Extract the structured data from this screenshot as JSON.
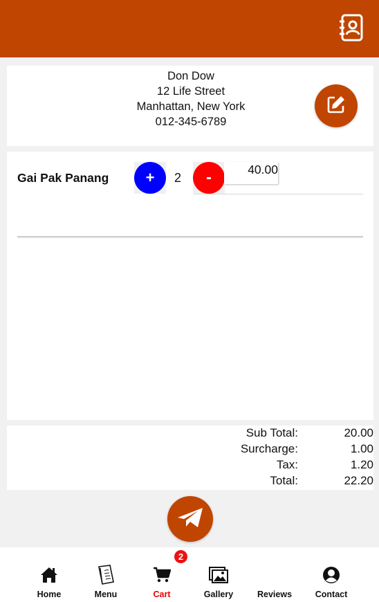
{
  "header": {
    "contacts_icon": "address-book-icon",
    "color": "#c04500"
  },
  "customer": {
    "name": "Don Dow",
    "street": "12 Life Street",
    "city": "Manhattan, New York",
    "phone": "012-345-6789",
    "edit_icon": "edit-icon"
  },
  "cart": {
    "items": [
      {
        "name": "Gai Pak Panang",
        "plus_label": "+",
        "quantity": "2",
        "minus_label": "-",
        "price": "40.00"
      }
    ]
  },
  "totals": {
    "subtotal_label": "Sub Total:",
    "subtotal": "20.00",
    "surcharge_label": "Surcharge:",
    "surcharge": "1.00",
    "tax_label": "Tax:",
    "tax": "1.20",
    "total_label": "Total:",
    "total": "22.20"
  },
  "send_icon": "paper-plane-icon",
  "nav": {
    "items": [
      {
        "label": "Home",
        "icon": "home-icon"
      },
      {
        "label": "Menu",
        "icon": "menu-book-icon"
      },
      {
        "label": "Cart",
        "icon": "cart-icon",
        "active": true
      },
      {
        "label": "Gallery",
        "icon": "gallery-icon"
      },
      {
        "label": "Reviews",
        "icon": ""
      },
      {
        "label": "Contact",
        "icon": "user-icon"
      }
    ],
    "cart_badge": "2",
    "active_color": "#ee0000"
  }
}
